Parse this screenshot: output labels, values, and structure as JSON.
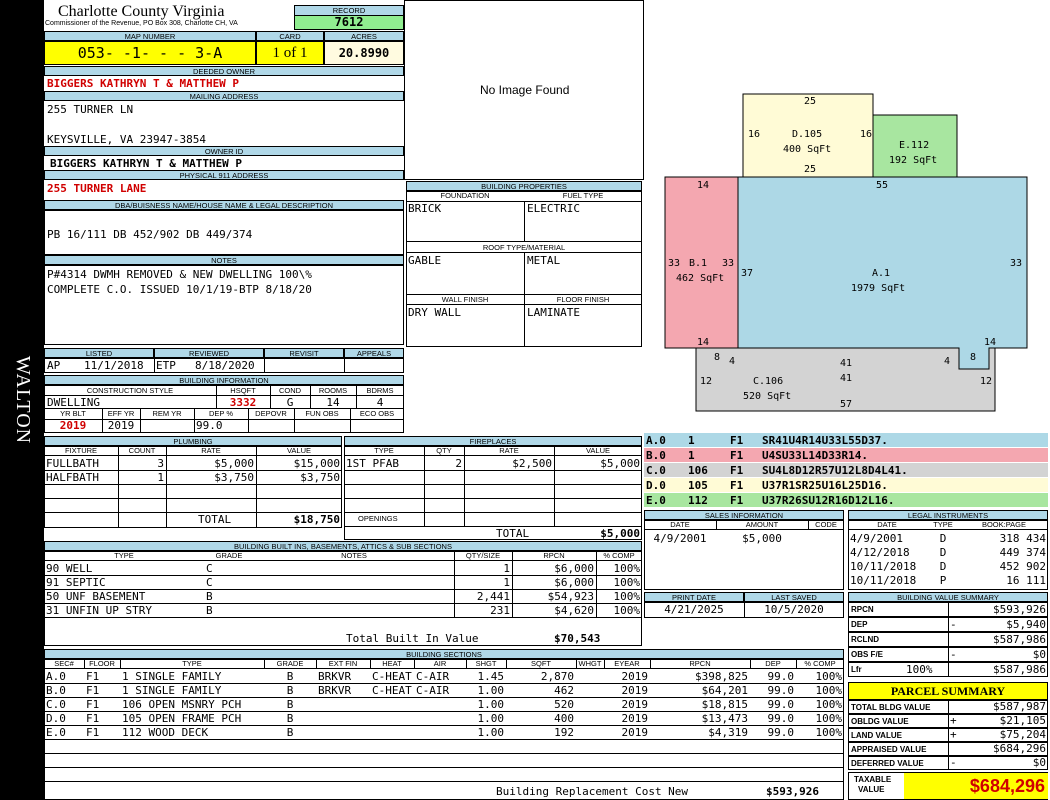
{
  "side_label": "WALTON",
  "header": {
    "county": "Charlotte County Virginia",
    "commissioner": "Commissioner of the Revenue, PO Box 308, Charlotte CH, VA",
    "record_label": "RECORD",
    "record": "7612"
  },
  "map": {
    "map_label": "MAP NUMBER",
    "map_number": "053- -1- - - 3-A",
    "card_label": "CARD",
    "card": "1 of 1",
    "acres_label": "ACRES",
    "acres": "20.8990"
  },
  "owner": {
    "deeded_label": "DEEDED OWNER",
    "deeded": "BIGGERS KATHRYN T & MATTHEW P",
    "mailing_label": "MAILING ADDRESS",
    "mail1": "255 TURNER LN",
    "mail2": "KEYSVILLE, VA 23947-3854",
    "owner_id_label": "OWNER ID",
    "owner_id": "BIGGERS KATHRYN T & MATTHEW P",
    "physical_label": "PHYSICAL 911 ADDRESS",
    "physical": "255 TURNER LANE"
  },
  "legal": {
    "label": "DBA/BUISNESS NAME/HOUSE NAME & LEGAL DESCRIPTION",
    "text": "PB 16/111 DB 452/902 DB 449/374"
  },
  "notes": {
    "label": "NOTES",
    "line1": "P#4314 DWMH REMOVED & NEW DWELLING 100\\%",
    "line2": "COMPLETE C.O. ISSUED 10/1/19-BTP 8/18/20"
  },
  "image": {
    "text": "No Image Found"
  },
  "bldg_props": {
    "label": "BUILDING PROPERTIES",
    "foundation_label": "FOUNDATION",
    "foundation": "BRICK",
    "fuel_label": "FUEL TYPE",
    "fuel": "ELECTRIC",
    "roof_label": "ROOF TYPE/MATERIAL",
    "roof_type": "GABLE",
    "roof_material": "METAL",
    "wall_label": "WALL FINISH",
    "wall": "DRY WALL",
    "floor_label": "FLOOR FINISH",
    "floor": "LAMINATE"
  },
  "listing": {
    "listed_label": "LISTED",
    "listed_by": "AP",
    "listed_date": "11/1/2018",
    "reviewed_label": "REVIEWED",
    "reviewed_by": "ETP",
    "reviewed_date": "8/18/2020",
    "revisit_label": "REVISIT",
    "appeals_label": "APPEALS"
  },
  "bldg_info": {
    "label": "BUILDING INFORMATION",
    "cs_label": "CONSTRUCTION STYLE",
    "cs": "DWELLING",
    "hsqft_label": "HSQFT",
    "hsqft": "3332",
    "cond_label": "COND",
    "cond": "G",
    "rooms_label": "ROOMS",
    "rooms": "14",
    "bdrms_label": "BDRMS",
    "bdrms": "4",
    "yrblt_label": "YR BLT",
    "yrblt": "2019",
    "effyr_label": "EFF YR",
    "effyr": "2019",
    "remyr_label": "REM YR",
    "dep_label": "DEP %",
    "dep": "99.0",
    "depovr_label": "DEPOVR",
    "funobs_label": "FUN OBS",
    "ecoobs_label": "ECO OBS"
  },
  "plumbing": {
    "label": "PLUMBING",
    "cols": [
      "FIXTURE",
      "COUNT",
      "RATE",
      "VALUE"
    ],
    "rows": [
      [
        "FULLBATH",
        "3",
        "$5,000",
        "$15,000"
      ],
      [
        "HALFBATH",
        "1",
        "$3,750",
        "$3,750"
      ]
    ],
    "total_label": "TOTAL",
    "total": "$18,750"
  },
  "fireplaces": {
    "label": "FIREPLACES",
    "cols": [
      "TYPE",
      "QTY",
      "RATE",
      "VALUE"
    ],
    "rows": [
      [
        "1ST PFAB",
        "2",
        "$2,500",
        "$5,000"
      ]
    ],
    "openings_label": "OPENINGS",
    "total_label": "TOTAL",
    "total": "$5,000"
  },
  "builtins": {
    "label": "BUILDING BUILT INS, BASEMENTS, ATTICS & SUB SECTIONS",
    "cols": [
      "TYPE",
      "GRADE",
      "NOTES",
      "QTY/SIZE",
      "RPCN",
      "% COMP"
    ],
    "rows": [
      [
        "90 WELL",
        "C",
        "",
        "1",
        "$6,000",
        "100%"
      ],
      [
        "91 SEPTIC",
        "C",
        "",
        "1",
        "$6,000",
        "100%"
      ],
      [
        "50 UNF BASEMENT",
        "B",
        "",
        "2,441",
        "$54,923",
        "100%"
      ],
      [
        "31 UNFIN UP STRY",
        "B",
        "",
        "231",
        "$4,620",
        "100%"
      ]
    ],
    "total_label": "Total Built In Value",
    "total": "$70,543"
  },
  "sketch": {
    "d_top": "25",
    "d_left": "16",
    "d_right": "16",
    "d_name": "D.105",
    "d_sqft": "400 SqFt",
    "d_bottom": "25",
    "e_name": "E.112",
    "e_sqft": "192 SqFt",
    "b_top": "14",
    "b_left": "33",
    "b_name": "B.1",
    "b_right": "33",
    "b_sqft": "462 SqFt",
    "b_bottom": "14",
    "a_top": "55",
    "a_left": "37",
    "a_name": "A.1",
    "a_sqft": "1979 SqFt",
    "a_right": "33",
    "a_bottom": "14",
    "a_bl": "41",
    "a_br4": "4",
    "a_br8": "8",
    "c_tl8": "8",
    "c_tl4": "4",
    "c_left": "12",
    "c_name": "C.106",
    "c_top": "41",
    "c_sqft": "520 SqFt",
    "c_right": "12",
    "c_bottom": "57"
  },
  "vectors": [
    {
      "id": "A.0",
      "n": "1",
      "f": "F1",
      "v": "SR41U4R14U33L55D37.",
      "color": "#add8e6"
    },
    {
      "id": "B.0",
      "n": "1",
      "f": "F1",
      "v": "U4SU33L14D33R14.",
      "color": "#f4a7b0"
    },
    {
      "id": "C.0",
      "n": "106",
      "f": "F1",
      "v": "SU4L8D12R57U12L8D4L41.",
      "color": "#d3d3d3"
    },
    {
      "id": "D.0",
      "n": "105",
      "f": "F1",
      "v": "U37R1SR25U16L25D16.",
      "color": "#fffbd6"
    },
    {
      "id": "E.0",
      "n": "112",
      "f": "F1",
      "v": "U37R26SU12R16D12L16.",
      "color": "#a8e6a0"
    }
  ],
  "sales": {
    "label": "SALES INFORMATION",
    "cols": [
      "DATE",
      "AMOUNT",
      "CODE"
    ],
    "rows": [
      [
        "4/9/2001",
        "$5,000",
        ""
      ]
    ]
  },
  "legal_inst": {
    "label": "LEGAL INSTRUMENTS",
    "cols": [
      "DATE",
      "TYPE",
      "BOOK:PAGE"
    ],
    "rows": [
      [
        "4/9/2001",
        "D",
        "318 434"
      ],
      [
        "4/12/2018",
        "D",
        "449 374"
      ],
      [
        "10/11/2018",
        "D",
        "452 902"
      ],
      [
        "10/11/2018",
        "P",
        "16 111"
      ]
    ]
  },
  "print": {
    "print_label": "PRINT DATE",
    "print_date": "4/21/2025",
    "saved_label": "LAST SAVED",
    "saved_date": "10/5/2020"
  },
  "bvs": {
    "label": "BUILDING VALUE SUMMARY",
    "rows": [
      [
        "RPCN",
        "",
        "$593,926"
      ],
      [
        "DEP",
        "-",
        "$5,940"
      ],
      [
        "RCLND",
        "",
        "$587,986"
      ],
      [
        "OBS F/E",
        "-",
        "$0"
      ],
      [
        "Lfr",
        "100%",
        "$587,986"
      ]
    ]
  },
  "sections": {
    "label": "BUILDING SECTIONS",
    "cols": [
      "SEC#",
      "FLOOR",
      "TYPE",
      "GRADE",
      "EXT FIN",
      "HEAT",
      "AIR",
      "SHGT",
      "SQFT",
      "WHGT",
      "EYEAR",
      "RPCN",
      "DEP",
      "% COMP"
    ],
    "rows": [
      [
        "A.0",
        "F1",
        "1 SINGLE FAMILY",
        "B",
        "BRKVR",
        "C-HEAT",
        "C-AIR",
        "1.45",
        "2,870",
        "",
        "2019",
        "$398,825",
        "99.0",
        "100%"
      ],
      [
        "B.0",
        "F1",
        "1 SINGLE FAMILY",
        "B",
        "BRKVR",
        "C-HEAT",
        "C-AIR",
        "1.00",
        "462",
        "",
        "2019",
        "$64,201",
        "99.0",
        "100%"
      ],
      [
        "C.0",
        "F1",
        "106 OPEN MSNRY PCH",
        "B",
        "",
        "",
        "",
        "1.00",
        "520",
        "",
        "2019",
        "$18,815",
        "99.0",
        "100%"
      ],
      [
        "D.0",
        "F1",
        "105 OPEN FRAME PCH",
        "B",
        "",
        "",
        "",
        "1.00",
        "400",
        "",
        "2019",
        "$13,473",
        "99.0",
        "100%"
      ],
      [
        "E.0",
        "F1",
        "112 WOOD DECK",
        "B",
        "",
        "",
        "",
        "1.00",
        "192",
        "",
        "2019",
        "$4,319",
        "99.0",
        "100%"
      ]
    ],
    "brcn_label": "Building Replacement Cost New",
    "brcn": "$593,926"
  },
  "parcel": {
    "label": "PARCEL SUMMARY",
    "rows": [
      [
        "TOTAL BLDG VALUE",
        "",
        "$587,987"
      ],
      [
        "OBLDG VALUE",
        "+",
        "$21,105"
      ],
      [
        "LAND VALUE",
        "+",
        "$75,204"
      ],
      [
        "APPRAISED VALUE",
        "",
        "$684,296"
      ],
      [
        "DEFERRED VALUE",
        "-",
        "$0"
      ]
    ],
    "taxable_label1": "TAXABLE",
    "taxable_label2": "VALUE",
    "taxable": "$684,296"
  }
}
